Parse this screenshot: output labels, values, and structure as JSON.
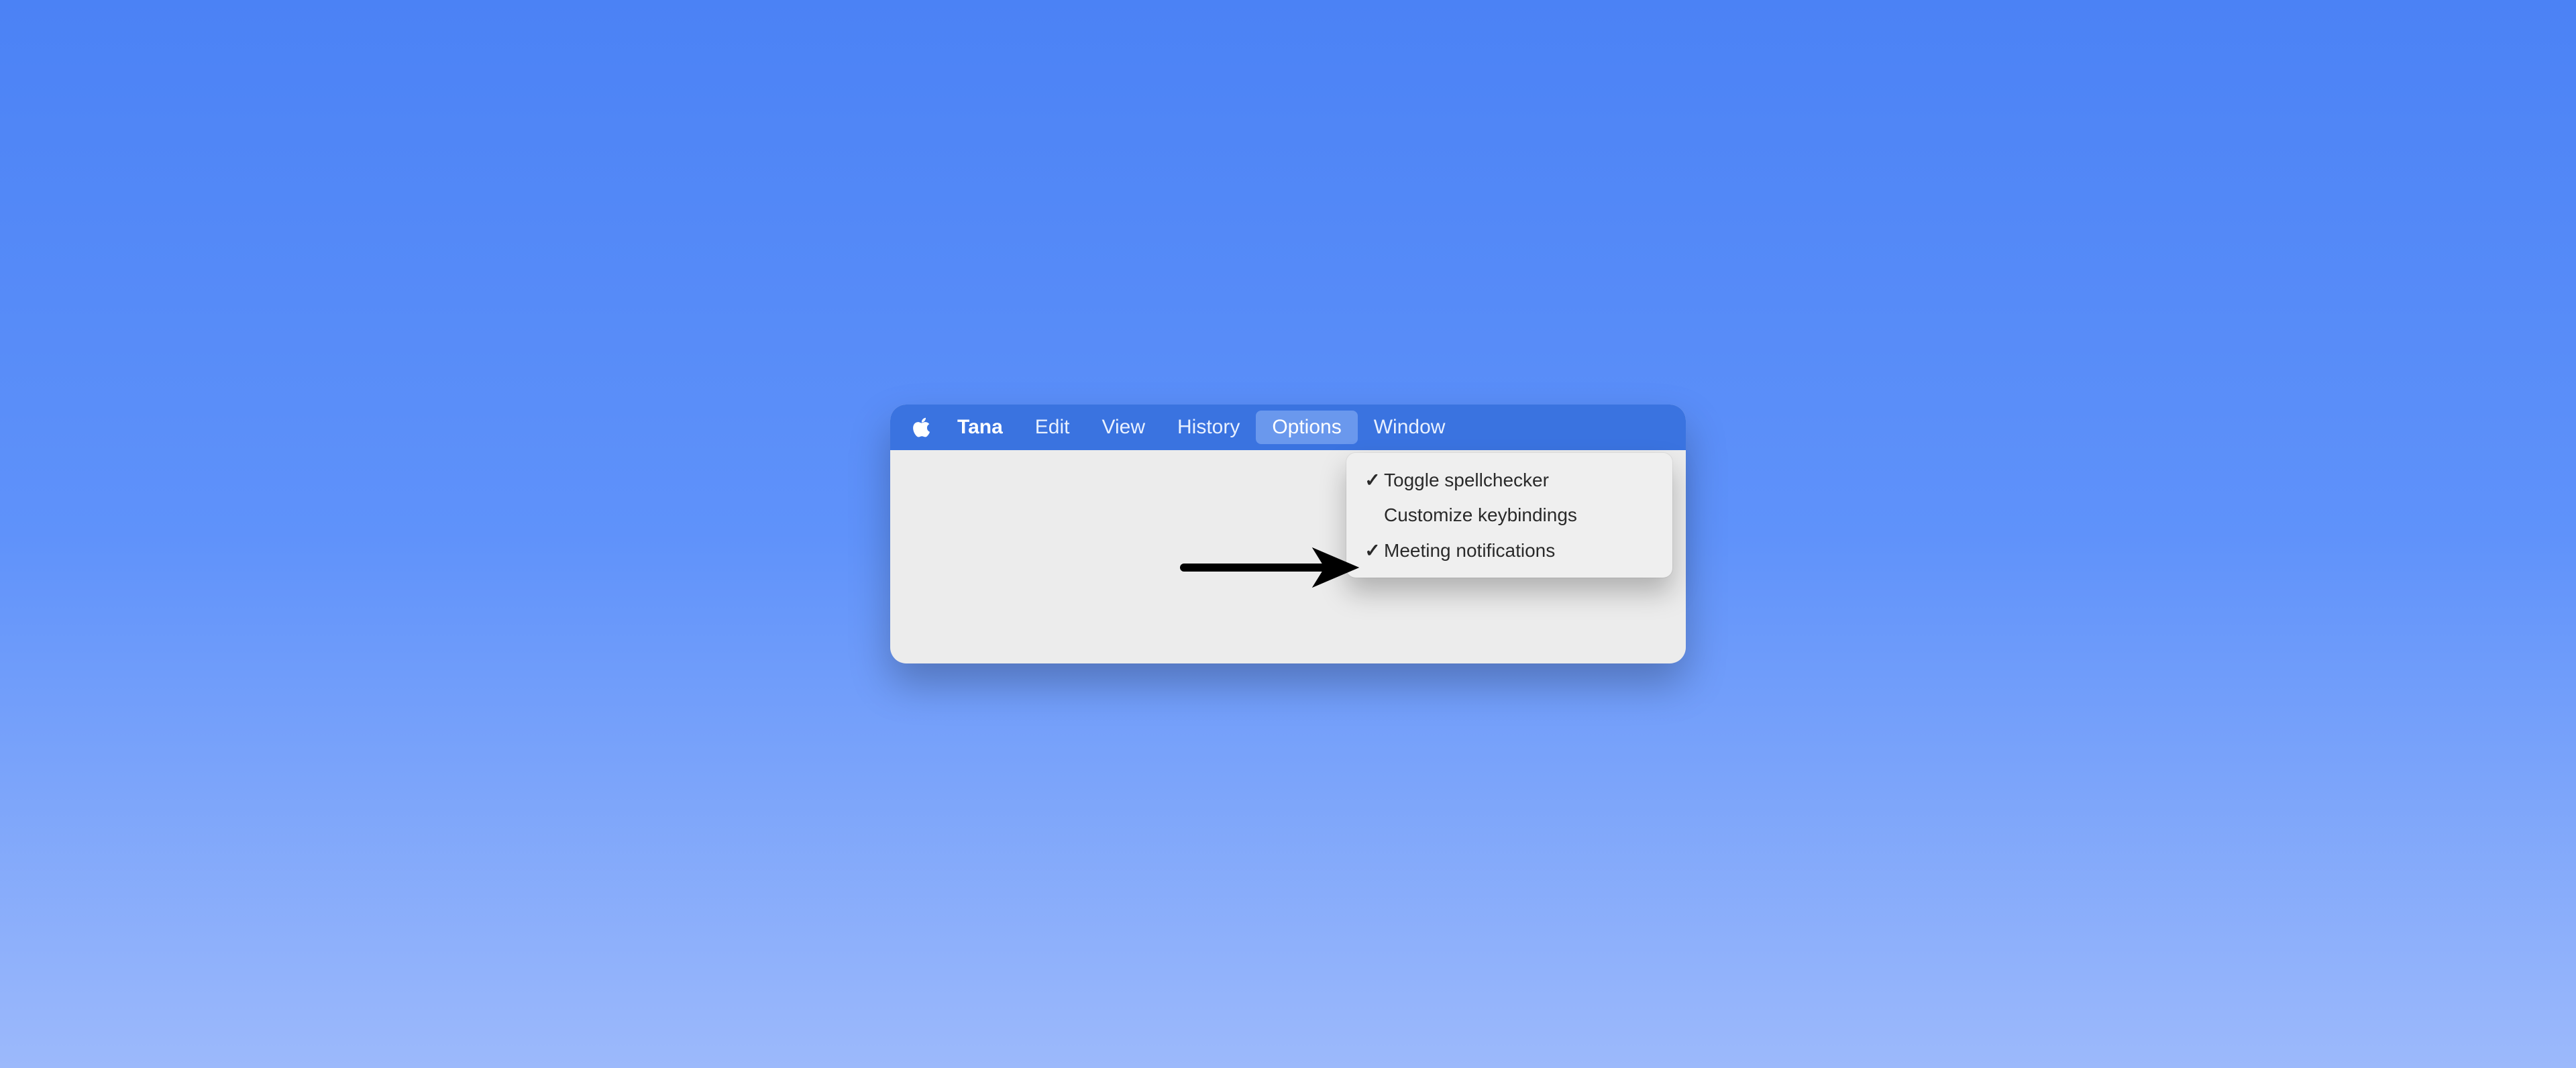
{
  "menubar": {
    "app_name": "Tana",
    "items": [
      {
        "label": "Edit"
      },
      {
        "label": "View"
      },
      {
        "label": "History"
      },
      {
        "label": "Options"
      },
      {
        "label": "Window"
      }
    ],
    "selected_index": 3
  },
  "dropdown": {
    "items": [
      {
        "label": "Toggle spellchecker",
        "checked": true
      },
      {
        "label": "Customize keybindings",
        "checked": false
      },
      {
        "label": "Meeting notifications",
        "checked": true
      }
    ]
  },
  "icons": {
    "checkmark": "✓"
  }
}
